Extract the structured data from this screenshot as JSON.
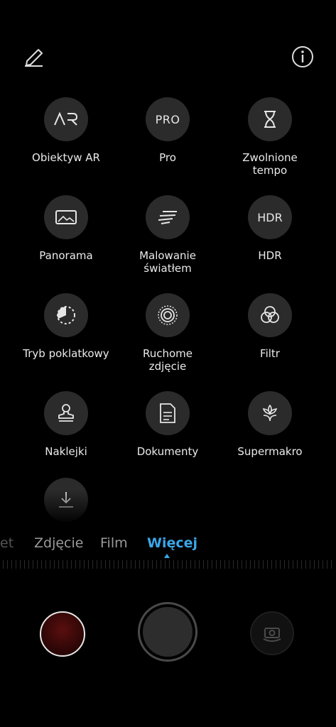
{
  "header": {
    "edit_icon": "pencil-edit-icon",
    "info_icon": "info-icon"
  },
  "modes": [
    {
      "label": "Obiektyw AR",
      "icon": "ar-icon",
      "glyph": "AR"
    },
    {
      "label": "Pro",
      "icon": "pro-icon",
      "glyph": "PRO"
    },
    {
      "label": "Zwolnione\ntempo",
      "icon": "hourglass-icon"
    },
    {
      "label": "Panorama",
      "icon": "panorama-icon"
    },
    {
      "label": "Malowanie\nświatłem",
      "icon": "light-painting-icon"
    },
    {
      "label": "HDR",
      "icon": "hdr-icon",
      "glyph": "HDR"
    },
    {
      "label": "Tryb poklatkowy",
      "icon": "timelapse-icon"
    },
    {
      "label": "Ruchome\nzdjęcie",
      "icon": "moving-picture-icon"
    },
    {
      "label": "Filtr",
      "icon": "filter-icon"
    },
    {
      "label": "Naklejki",
      "icon": "stamp-icon"
    },
    {
      "label": "Dokumenty",
      "icon": "document-icon"
    },
    {
      "label": "Supermakro",
      "icon": "flower-macro-icon"
    },
    {
      "label": "",
      "icon": "download-icon"
    }
  ],
  "tabs": {
    "partial": "et",
    "photo": "Zdjęcie",
    "video": "Film",
    "more": "Więcej",
    "active": "Więcej"
  },
  "bottom_controls": {
    "gallery_icon": "gallery-thumbnail",
    "shutter_icon": "shutter-button",
    "switch_icon": "switch-camera-icon"
  },
  "colors": {
    "accent": "#3aa7e8",
    "circle_bg": "#2b2b2b",
    "background": "#000000"
  }
}
